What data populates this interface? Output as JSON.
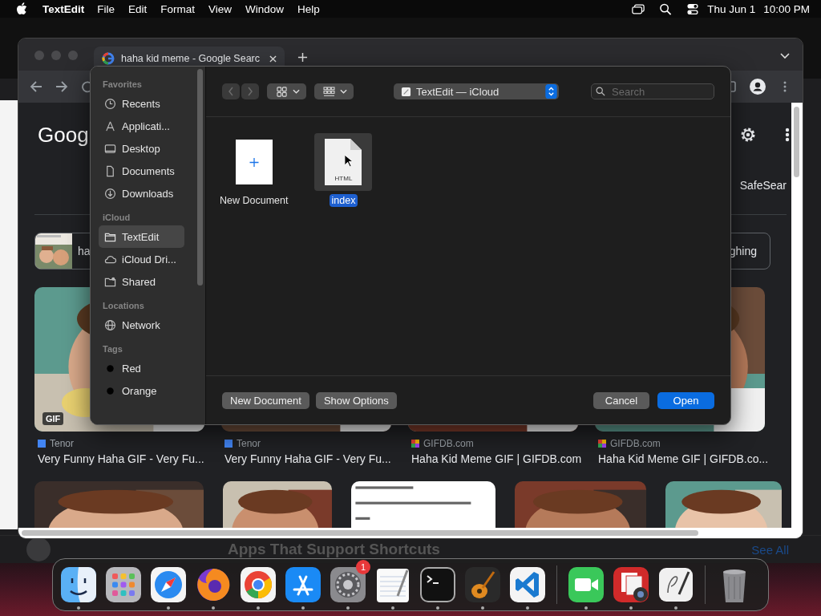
{
  "menu_bar": {
    "app": "TextEdit",
    "menus": [
      "File",
      "Edit",
      "Format",
      "View",
      "Window",
      "Help"
    ],
    "date": "Thu Jun 1",
    "time": "10:00 PM"
  },
  "back_window": {
    "heading": "Apps That Support Shortcuts",
    "link": "See All"
  },
  "browser": {
    "tab": {
      "title": "haha kid meme - Google Searc",
      "selected": true
    },
    "logo": "Goog",
    "safe_search": "SafeSear",
    "chips": [
      {
        "kind": "thumb",
        "label": "ha"
      },
      {
        "kind": "text",
        "label": "ghing"
      }
    ],
    "results": [
      {
        "kind": "picture",
        "badge": "GIF",
        "source": "Tenor",
        "title": "Very Funny Haha GIF - Very Fu..."
      },
      {
        "kind": "picture",
        "source": "Tenor",
        "title": "Very Funny Haha GIF - Very Fu..."
      },
      {
        "kind": "picture",
        "source": "GIFDB.com",
        "title": "Haha Kid Meme GIF | GIFDB.com"
      },
      {
        "kind": "picture",
        "source": "GIFDB.com",
        "title": "Haha Kid Meme GIF | GIFDB.co..."
      }
    ]
  },
  "dialog": {
    "location": "TextEdit — iCloud",
    "search": {
      "placeholder": "Search"
    },
    "sidebar": [
      {
        "heading": "Favorites",
        "items": [
          {
            "label": "Recents",
            "kind": "clock",
            "selected": false
          },
          {
            "label": "Applicati...",
            "kind": "apps",
            "selected": false
          },
          {
            "label": "Desktop",
            "kind": "desktop",
            "selected": false
          },
          {
            "label": "Documents",
            "kind": "document",
            "selected": false
          },
          {
            "label": "Downloads",
            "kind": "download",
            "selected": false
          }
        ]
      },
      {
        "heading": "iCloud",
        "items": [
          {
            "label": "TextEdit",
            "kind": "folder",
            "selected": true
          },
          {
            "label": "iCloud Dri...",
            "kind": "cloud",
            "selected": false
          },
          {
            "label": "Shared",
            "kind": "shared",
            "selected": false
          }
        ]
      },
      {
        "heading": "Locations",
        "items": [
          {
            "label": "Network",
            "kind": "globe",
            "selected": false
          }
        ]
      },
      {
        "heading": "Tags",
        "items": [
          {
            "label": "Red",
            "kind": "tag",
            "selected": false
          },
          {
            "label": "Orange",
            "kind": "tag",
            "selected": false
          }
        ]
      }
    ],
    "files": [
      {
        "name": "New Document",
        "kind": "new",
        "selected": false
      },
      {
        "name": "index",
        "kind": "html",
        "file_type": "HTML",
        "selected": true
      }
    ],
    "left_buttons": [
      "New Document",
      "Show Options"
    ],
    "cancel": "Cancel",
    "open": "Open"
  },
  "dock": [
    {
      "kind": "finder",
      "running": true
    },
    {
      "kind": "launchpad",
      "running": false
    },
    {
      "kind": "safari",
      "running": true
    },
    {
      "kind": "firefox",
      "running": true
    },
    {
      "kind": "chrome",
      "running": true
    },
    {
      "kind": "appstore",
      "running": true
    },
    {
      "kind": "settings",
      "running": true,
      "badge": "1"
    },
    {
      "kind": "textedit",
      "running": true
    },
    {
      "kind": "terminal",
      "running": true
    },
    {
      "kind": "garageband",
      "running": true
    },
    {
      "kind": "vscode",
      "running": true
    },
    {
      "kind": "separator"
    },
    {
      "kind": "facetime",
      "running": true
    },
    {
      "kind": "photobooth",
      "running": true
    },
    {
      "kind": "scripteditor",
      "running": true
    },
    {
      "kind": "separator"
    },
    {
      "kind": "trash",
      "running": false
    }
  ]
}
